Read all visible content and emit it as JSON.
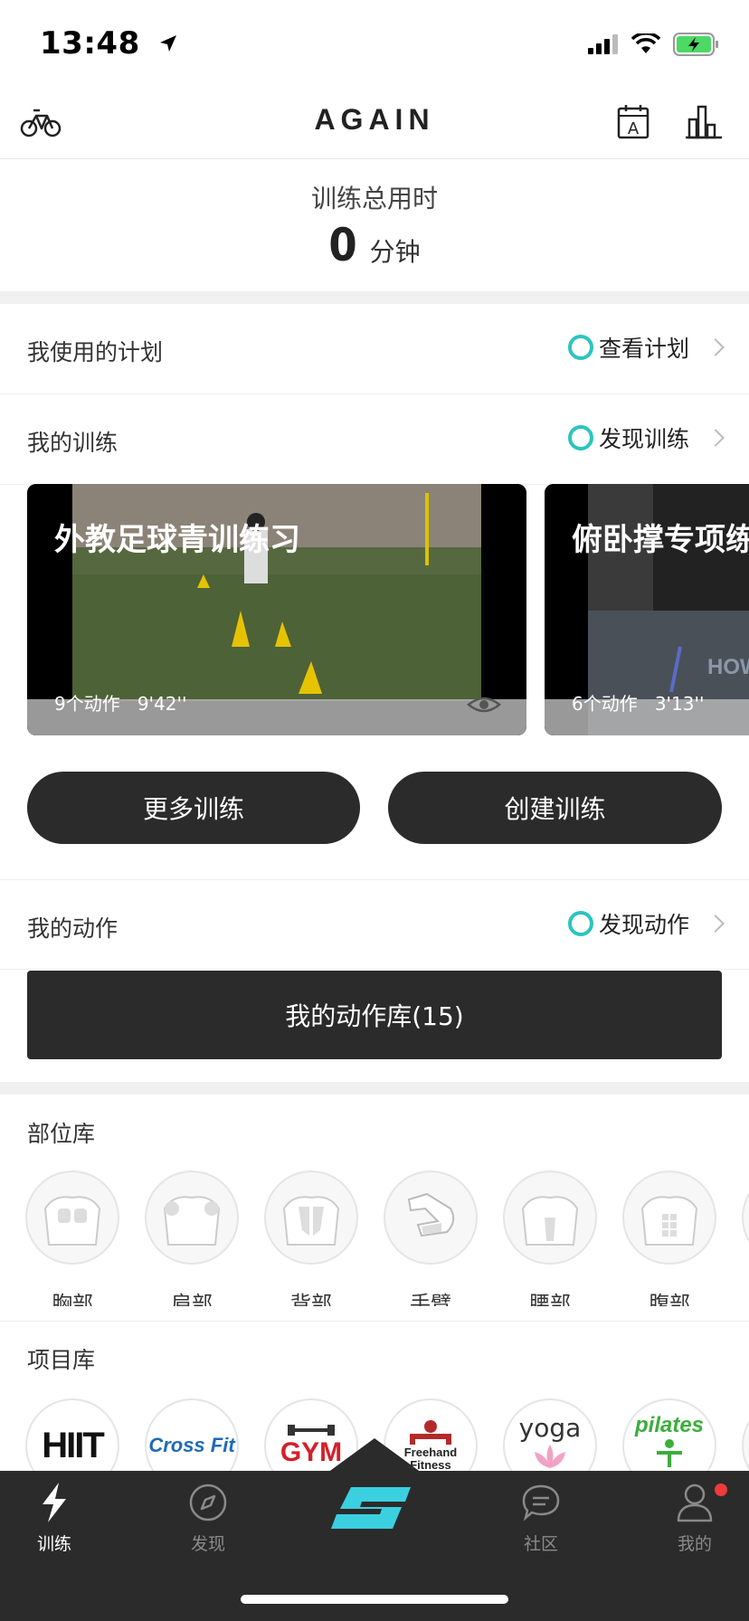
{
  "status_bar": {
    "time": "13:48"
  },
  "nav": {
    "brand": "AGAIN",
    "left_icon": "bicycle-icon",
    "right_icons": [
      "calendar-a-icon",
      "bar-chart-icon"
    ]
  },
  "summary": {
    "label": "训练总用时",
    "value": "0",
    "unit": "分钟"
  },
  "plans": {
    "title": "我使用的计划",
    "action": "查看计划"
  },
  "trainings": {
    "title": "我的训练",
    "action": "发现训练",
    "cards": [
      {
        "title": "外教足球青训练习",
        "count": "9个动作",
        "duration": "9'42''"
      },
      {
        "title": "俯卧撑专项练习",
        "count": "6个动作",
        "duration": "3'13''"
      }
    ],
    "more_button": "更多训练",
    "create_button": "创建训练"
  },
  "moves": {
    "title": "我的动作",
    "action": "发现动作",
    "library_button": "我的动作库(15)"
  },
  "body_parts": {
    "title": "部位库",
    "items": [
      {
        "label": "胸部",
        "icon": "chest-icon"
      },
      {
        "label": "肩部",
        "icon": "shoulder-icon"
      },
      {
        "label": "背部",
        "icon": "back-icon"
      },
      {
        "label": "手臂",
        "icon": "arm-icon"
      },
      {
        "label": "腰部",
        "icon": "waist-icon"
      },
      {
        "label": "腹部",
        "icon": "abs-icon"
      }
    ]
  },
  "projects": {
    "title": "项目库",
    "items": [
      {
        "label": "HIIT"
      },
      {
        "label": "Cross Fit"
      },
      {
        "label": "GYM"
      },
      {
        "label": "Freehand Fitness"
      },
      {
        "label": "yoga"
      },
      {
        "label": "pilates"
      }
    ]
  },
  "tabs": [
    {
      "label": "训练",
      "icon": "lightning-icon",
      "active": true
    },
    {
      "label": "发现",
      "icon": "compass-icon",
      "active": false
    },
    {
      "label": "社区",
      "icon": "chat-icon",
      "active": false
    },
    {
      "label": "我的",
      "icon": "user-icon",
      "active": false
    }
  ],
  "colors": {
    "accent": "#2cc4be",
    "dark": "#2b2b2b",
    "badge": "#f03a3a"
  }
}
